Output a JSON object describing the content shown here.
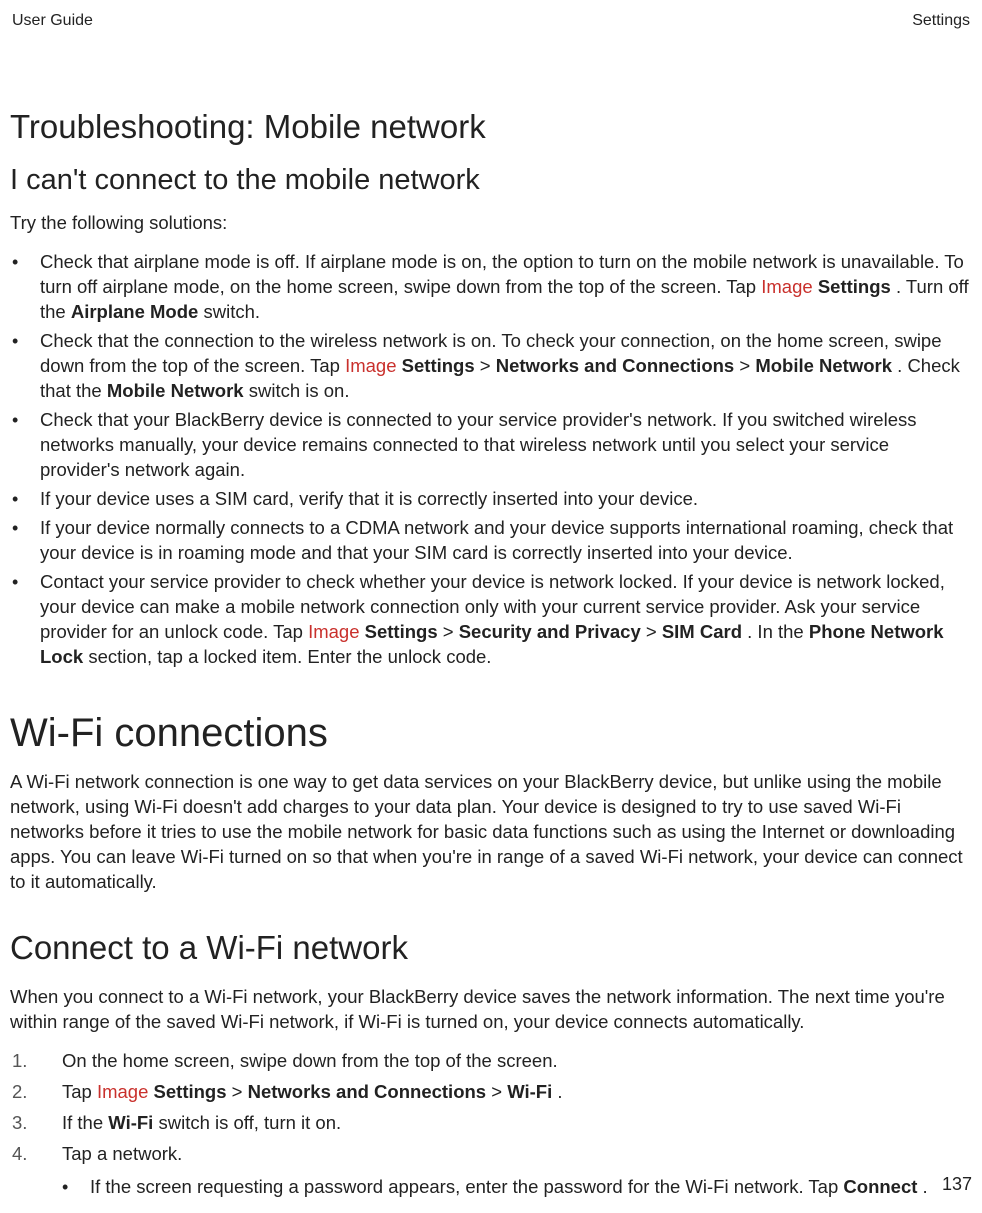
{
  "header": {
    "left": "User Guide",
    "right": "Settings"
  },
  "sec1": {
    "title": "Troubleshooting: Mobile network",
    "subtitle": "I can't connect to the mobile network",
    "intro": "Try the following solutions:",
    "bullets": {
      "b1": {
        "t1": "Check that airplane mode is off. If airplane mode is on, the option to turn on the mobile network is unavailable. To turn off airplane mode, on the home screen, swipe down from the top of the screen. Tap ",
        "img": "Image",
        "t2": " ",
        "bold1": "Settings",
        "t3": ". Turn off the ",
        "bold2": "Airplane Mode",
        "t4": " switch."
      },
      "b2": {
        "t1": "Check that the connection to the wireless network is on. To check your connection, on the home screen, swipe down from the top of the screen. Tap ",
        "img": "Image",
        "t2": " ",
        "bold1": "Settings",
        "t3": " > ",
        "bold2": "Networks and Connections",
        "t4": " > ",
        "bold3": "Mobile Network",
        "t5": ". Check that the ",
        "bold4": "Mobile Network",
        "t6": " switch is on."
      },
      "b3": "Check that your BlackBerry device is connected to your service provider's network. If you switched wireless networks manually, your device remains connected to that wireless network until you select your service provider's network again.",
      "b4": "If your device uses a SIM card, verify that it is correctly inserted into your device.",
      "b5": "If your device normally connects to a CDMA network and your device supports international roaming, check that your device is in roaming mode and that your SIM card is correctly inserted into your device.",
      "b6": {
        "t1": "Contact your service provider to check whether your device is network locked. If your device is network locked, your device can make a mobile network connection only with your current service provider. Ask your service provider for an unlock code. Tap ",
        "img": "Image",
        "t2": " ",
        "bold1": "Settings",
        "t3": " > ",
        "bold2": "Security and Privacy",
        "t4": " > ",
        "bold3": "SIM Card",
        "t5": ". In the ",
        "bold4": "Phone Network Lock",
        "t6": " section, tap a locked item. Enter the unlock code."
      }
    }
  },
  "sec2": {
    "title": "Wi-Fi connections",
    "para": "A Wi-Fi network connection is one way to get data services on your BlackBerry device, but unlike using the mobile network, using Wi-Fi doesn't add charges to your data plan. Your device is designed to try to use saved Wi-Fi networks before it tries to use the mobile network for basic data functions such as using the Internet or downloading apps. You can leave Wi-Fi turned on so that when you're in range of a saved Wi-Fi network, your device can connect to it automatically."
  },
  "sec3": {
    "title": "Connect to a Wi-Fi network",
    "para": "When you connect to a Wi-Fi network, your BlackBerry device saves the network information. The next time you're within range of the saved Wi-Fi network, if Wi-Fi is turned on, your device connects automatically.",
    "steps": {
      "s1": {
        "num": "1.",
        "text": "On the home screen, swipe down from the top of the screen."
      },
      "s2": {
        "num": "2.",
        "t1": "Tap ",
        "img": "Image",
        "t2": " ",
        "bold1": "Settings",
        "t3": " > ",
        "bold2": "Networks and Connections",
        "t4": " > ",
        "bold3": "Wi-Fi",
        "t5": "."
      },
      "s3": {
        "num": "3.",
        "t1": "If the ",
        "bold1": "Wi-Fi",
        "t2": " switch is off, turn it on."
      },
      "s4": {
        "num": "4.",
        "text": "Tap a network."
      },
      "sub1": {
        "t1": "If the screen requesting a password appears, enter the password for the Wi-Fi network. Tap ",
        "bold1": "Connect",
        "t2": "."
      }
    }
  },
  "page_number": "137"
}
